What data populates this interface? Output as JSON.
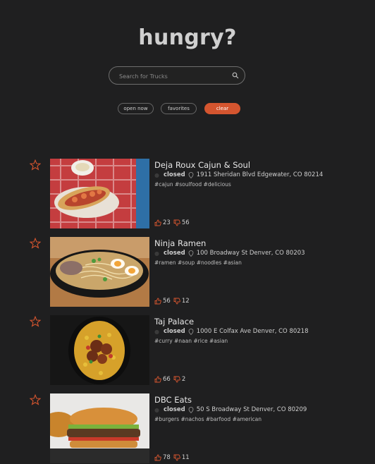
{
  "header": {
    "title": "hungry?"
  },
  "search": {
    "placeholder": "Search for Trucks"
  },
  "filters": {
    "open_now": "open now",
    "favorites": "favorites",
    "clear": "clear"
  },
  "colors": {
    "accent": "#d4552f",
    "background": "#1f1f20"
  },
  "trucks": [
    {
      "name": "Deja Roux Cajun & Soul",
      "status": "closed",
      "address": "1911 Sheridan Blvd Edgewater, CO 80214",
      "tags": "#cajun #soulfood #delicious",
      "upvotes": "23",
      "downvotes": "56",
      "image": "po-boy sandwich with shrimp"
    },
    {
      "name": "Ninja Ramen",
      "status": "closed",
      "address": "100 Broadway St Denver, CO 80203",
      "tags": "#ramen #soup #noodles #asian",
      "upvotes": "56",
      "downvotes": "12",
      "image": "bowl of ramen with egg"
    },
    {
      "name": "Taj Palace",
      "status": "closed",
      "address": "1000 E Colfax Ave Denver, CO 80218",
      "tags": "#curry #naan #rice #asian",
      "upvotes": "66",
      "downvotes": "2",
      "image": "curry with rice"
    },
    {
      "name": "DBC Eats",
      "status": "closed",
      "address": "50 S Broadway St Denver, CO 80209",
      "tags": "#burgers #nachos #barfood #american",
      "upvotes": "78",
      "downvotes": "11",
      "image": "burger"
    }
  ]
}
